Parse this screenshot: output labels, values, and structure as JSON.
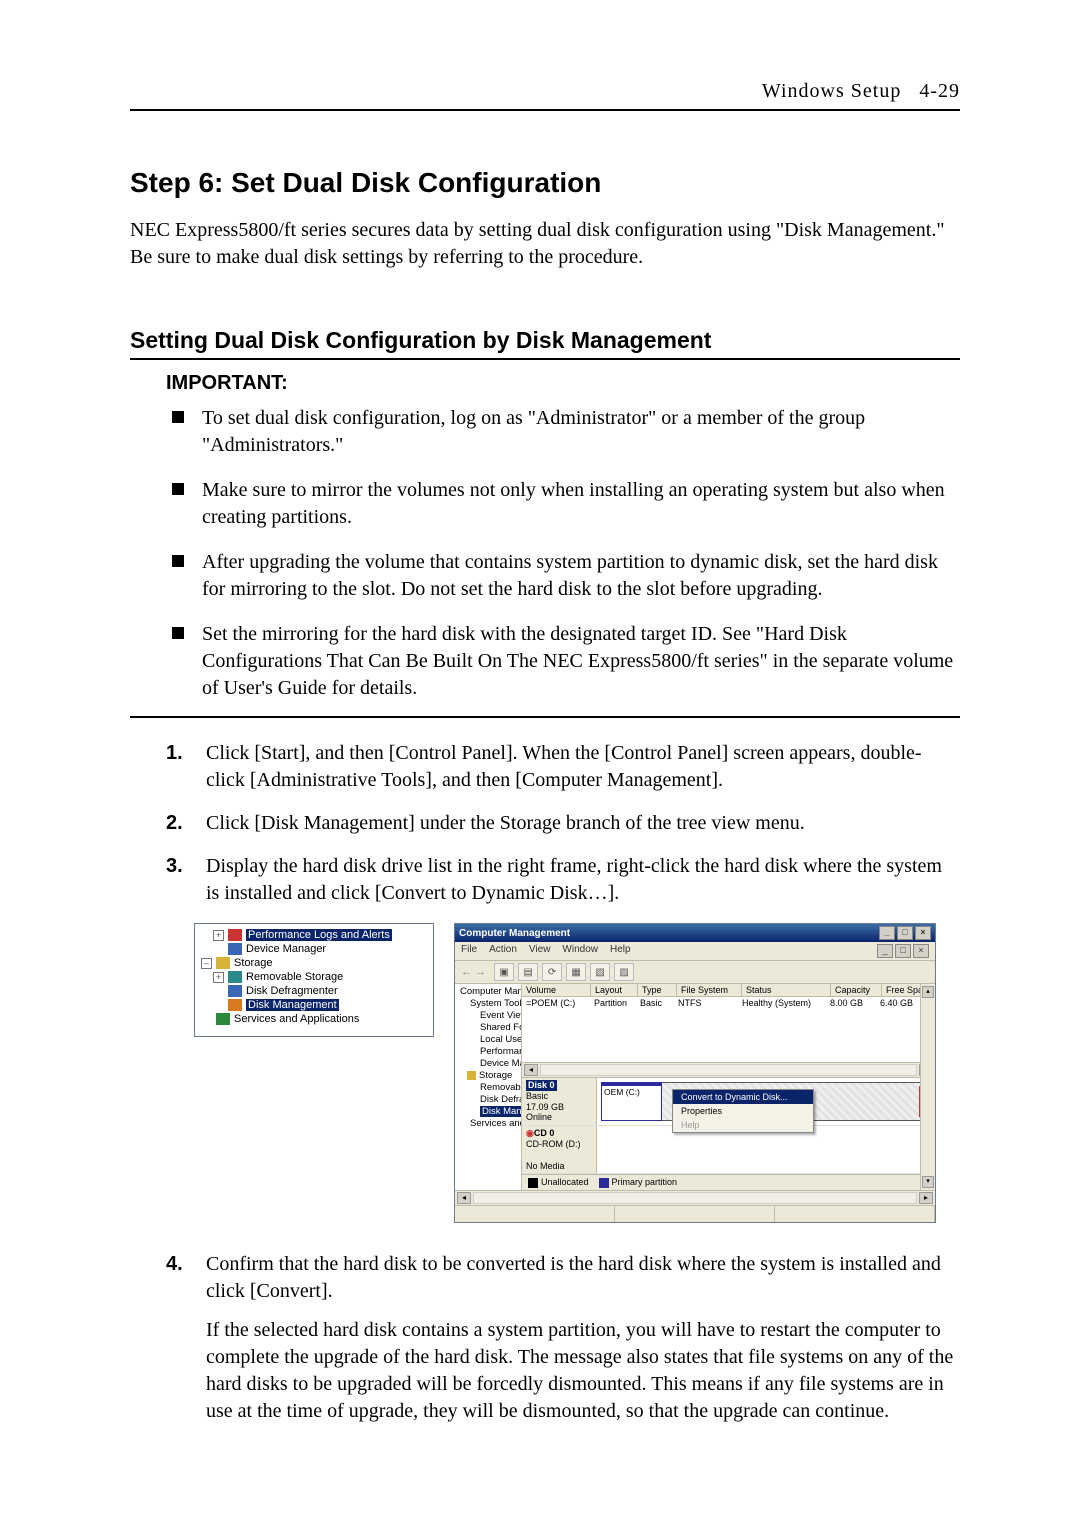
{
  "header": {
    "section": "Windows Setup",
    "page": "4-29"
  },
  "title": "Step 6: Set Dual Disk Configuration",
  "intro": "NEC Express5800/ft series secures data by setting dual disk configuration using \"Disk Management.\" Be sure to make dual disk settings by referring to the procedure.",
  "subtitle": "Setting Dual Disk Configuration by Disk Management",
  "important": {
    "label": "IMPORTANT:",
    "items": [
      "To set dual disk configuration, log on as \"Administrator\" or a member of the group \"Administrators.\"",
      "Make sure to mirror the volumes not only when installing an operating system but also when creating partitions.",
      "After upgrading the volume that contains system partition to dynamic disk, set the hard disk for mirroring to the slot. Do not set the hard disk to the slot before upgrading.",
      "Set the mirroring for the hard disk with the designated target ID. See \"Hard Disk Configurations That Can Be Built On The NEC Express5800/ft series\" in the separate volume of User's Guide for details."
    ]
  },
  "steps": [
    "Click [Start], and then [Control Panel]. When the [Control Panel] screen appears, double-click [Administrative Tools], and then [Computer Management].",
    "Click [Disk Management] under the Storage branch of the tree view menu.",
    "Display the hard disk drive list in the right frame, right-click the hard disk where the system is installed and click [Convert to Dynamic Disk…]."
  ],
  "step4": {
    "num": "4.",
    "text": "Confirm that the hard disk to be converted is the hard disk where the system is installed and click [Convert].",
    "follow": "If the selected hard disk contains a system partition, you will have to restart the computer to complete the upgrade of the hard disk. The message also states that file systems on any of the hard disks to be upgraded will be forcedly dismounted. This means if any file systems are in use at the time of upgrade, they will be dismounted, so that the upgrade can continue."
  },
  "tree_shot": {
    "items": [
      {
        "indent": 1,
        "exp": "+",
        "icon": "red",
        "label": "Performance Logs and Alerts",
        "sel": true
      },
      {
        "indent": 1,
        "exp": "",
        "icon": "blue",
        "label": "Device Manager"
      },
      {
        "indent": 0,
        "exp": "-",
        "icon": "yellow",
        "label": "Storage"
      },
      {
        "indent": 1,
        "exp": "+",
        "icon": "teal",
        "label": "Removable Storage"
      },
      {
        "indent": 1,
        "exp": "",
        "icon": "blue",
        "label": "Disk Defragmenter"
      },
      {
        "indent": 1,
        "exp": "",
        "icon": "orange",
        "label": "Disk Management",
        "sel": true
      },
      {
        "indent": 0,
        "exp": "",
        "icon": "green",
        "label": "Services and Applications"
      }
    ]
  },
  "mgmt": {
    "title": "Computer Management",
    "menu": [
      "File",
      "Action",
      "View",
      "Window",
      "Help"
    ],
    "toolbar_arrows": "←  →",
    "tree": [
      {
        "i": 0,
        "c": "gr",
        "t": "Computer Management (Local)"
      },
      {
        "i": 1,
        "c": "b",
        "t": "System Tools"
      },
      {
        "i": 2,
        "c": "y",
        "t": "Event Viewer"
      },
      {
        "i": 2,
        "c": "b",
        "t": "Shared Folders"
      },
      {
        "i": 2,
        "c": "g",
        "t": "Local Users and Groups"
      },
      {
        "i": 2,
        "c": "r",
        "t": "Performance Logs and Alerts"
      },
      {
        "i": 2,
        "c": "b",
        "t": "Device Manager"
      },
      {
        "i": 1,
        "c": "y",
        "t": "Storage"
      },
      {
        "i": 2,
        "c": "t",
        "t": "Removable Storage"
      },
      {
        "i": 2,
        "c": "b",
        "t": "Disk Defragmenter"
      },
      {
        "i": 2,
        "c": "r",
        "t": "Disk Management",
        "sel": true
      },
      {
        "i": 1,
        "c": "g",
        "t": "Services and Applications"
      }
    ],
    "vol_headers": [
      "Volume",
      "Layout",
      "Type",
      "File System",
      "Status",
      "Capacity",
      "Free Spac"
    ],
    "vol_row": [
      "=POEM (C:)",
      "Partition",
      "Basic",
      "NTFS",
      "Healthy (System)",
      "8.00 GB",
      "6.40 GB"
    ],
    "disk0": {
      "name": "Disk 0",
      "kind": "Basic",
      "size": "17.09 GB",
      "state": "Online",
      "part1_name": "OEM (C:)",
      "ctx": {
        "convert": "Convert to Dynamic Disk...",
        "properties": "Properties",
        "help": "Help"
      }
    },
    "cdrom": {
      "name": "CD-ROM (D:)",
      "icon_label": "CD 0",
      "state": "No Media"
    },
    "legend": {
      "unalloc": "Unallocated",
      "primary": "Primary partition"
    }
  }
}
